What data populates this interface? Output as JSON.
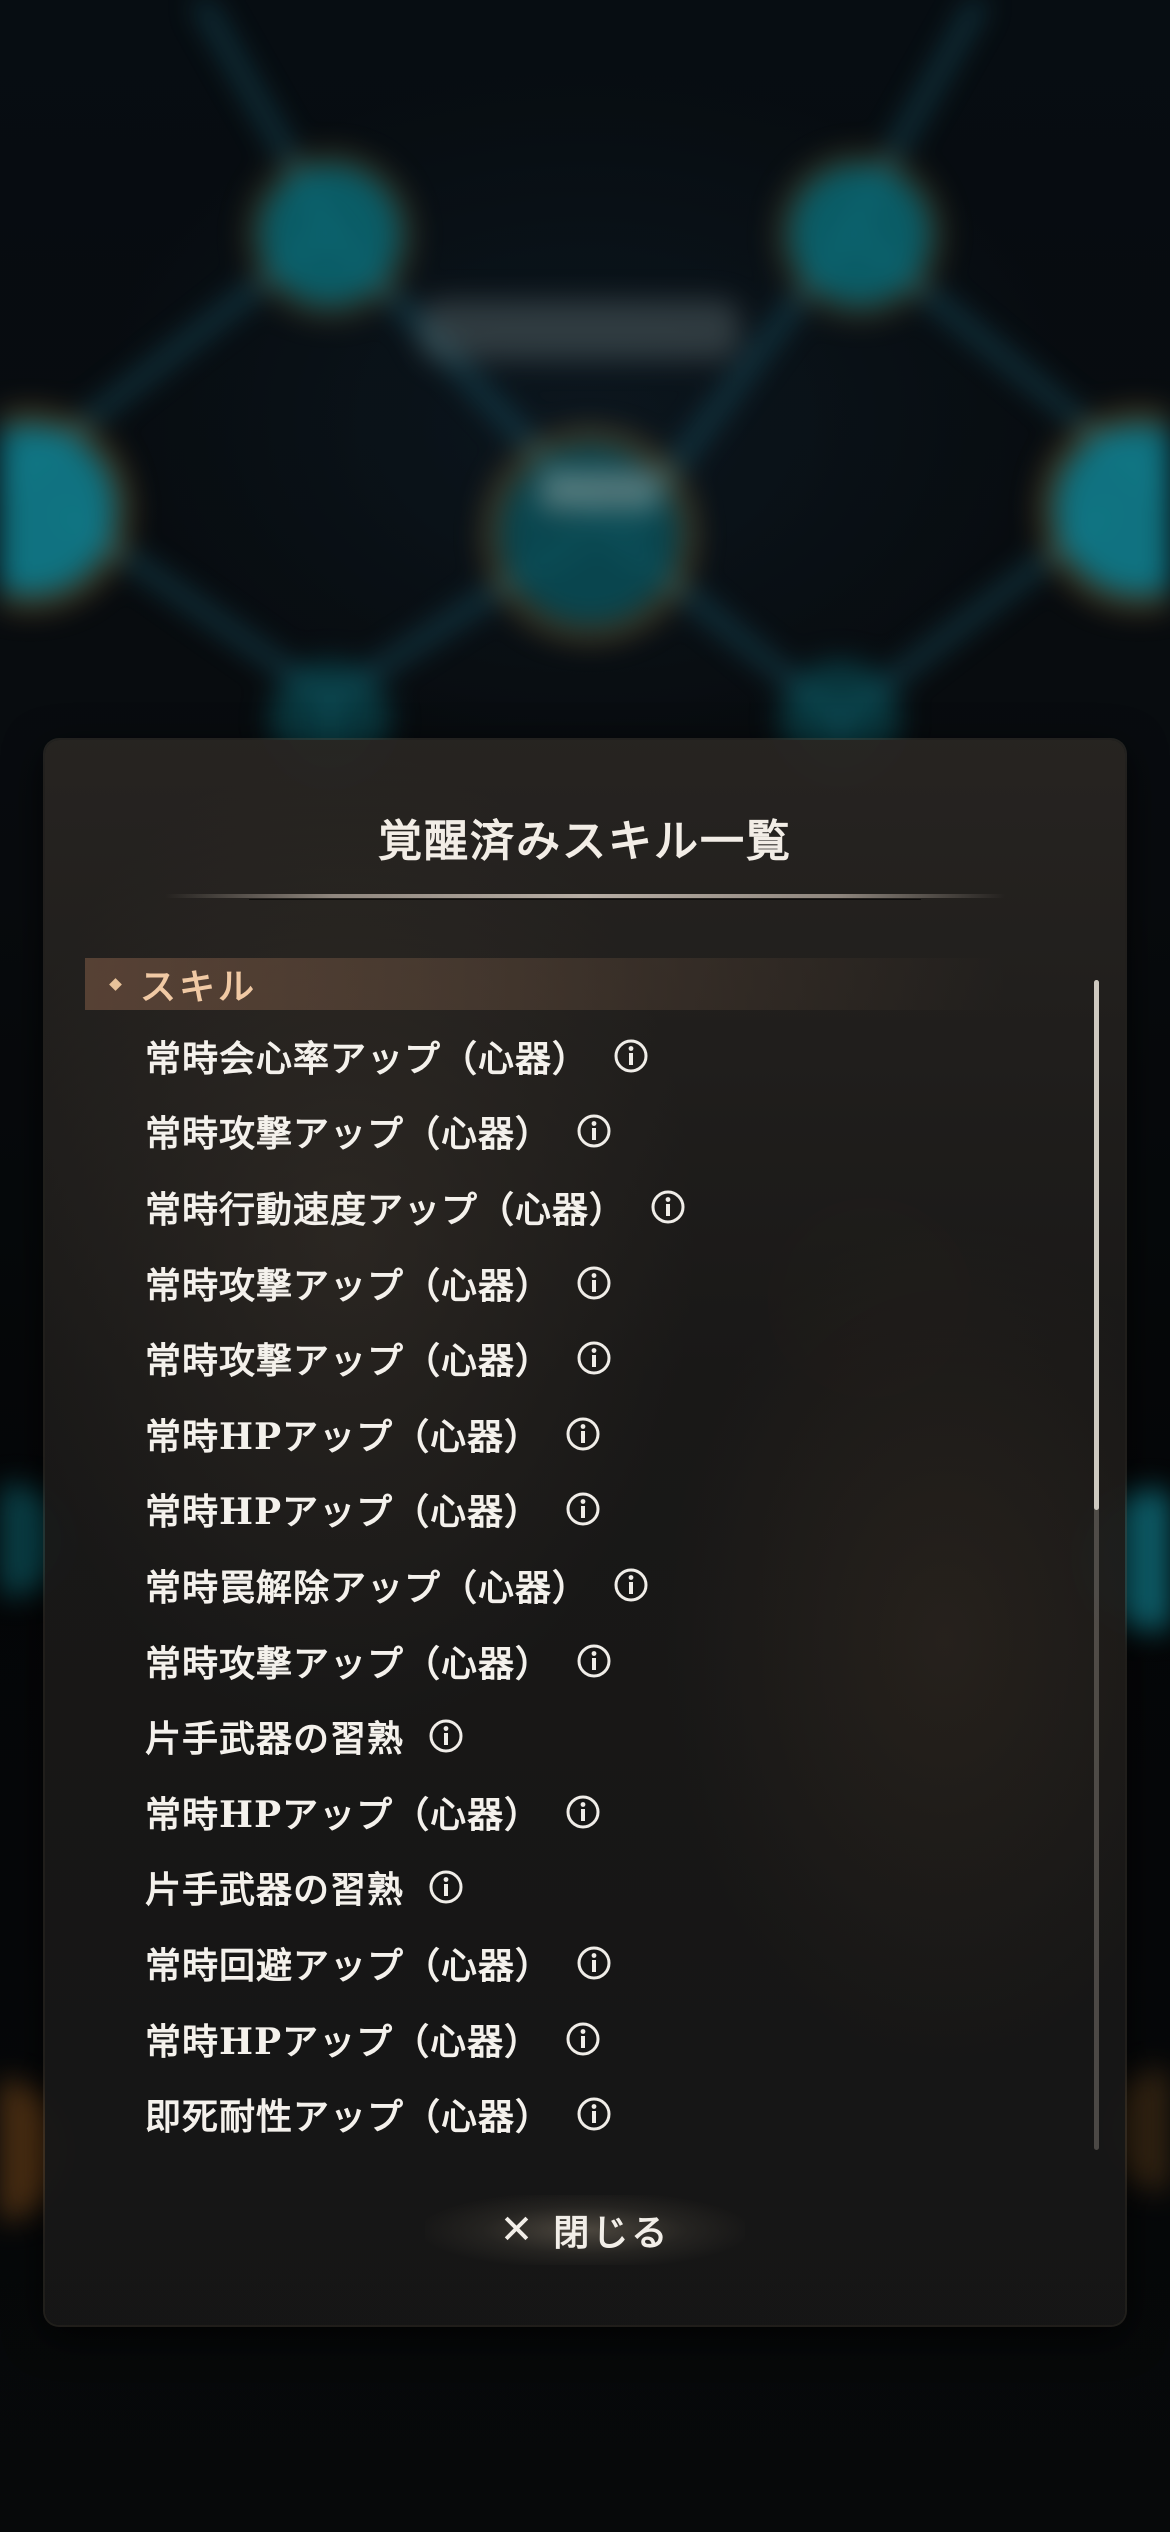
{
  "dialog": {
    "title": "覚醒済みスキル一覧",
    "section_label": "スキル",
    "close_label": "閉じる",
    "close_icon": "close-x-icon"
  },
  "skills": [
    {
      "name": "常時会心率アップ（心器）",
      "icon": "info-icon"
    },
    {
      "name": "常時攻撃アップ（心器）",
      "icon": "info-icon"
    },
    {
      "name": "常時行動速度アップ（心器）",
      "icon": "info-icon"
    },
    {
      "name": "常時攻撃アップ（心器）",
      "icon": "info-icon"
    },
    {
      "name": "常時攻撃アップ（心器）",
      "icon": "info-icon"
    },
    {
      "name": "常時HPアップ（心器）",
      "icon": "info-icon"
    },
    {
      "name": "常時HPアップ（心器）",
      "icon": "info-icon"
    },
    {
      "name": "常時罠解除アップ（心器）",
      "icon": "info-icon"
    },
    {
      "name": "常時攻撃アップ（心器）",
      "icon": "info-icon"
    },
    {
      "name": "片手武器の習熟",
      "icon": "info-icon"
    },
    {
      "name": "常時HPアップ（心器）",
      "icon": "info-icon"
    },
    {
      "name": "片手武器の習熟",
      "icon": "info-icon"
    },
    {
      "name": "常時回避アップ（心器）",
      "icon": "info-icon"
    },
    {
      "name": "常時HPアップ（心器）",
      "icon": "info-icon"
    },
    {
      "name": "即死耐性アップ（心器）",
      "icon": "info-icon"
    }
  ],
  "colors": {
    "section_accent": "#f0c9a4",
    "text": "#f4f1ec",
    "background_glow": "#18c8d8"
  }
}
